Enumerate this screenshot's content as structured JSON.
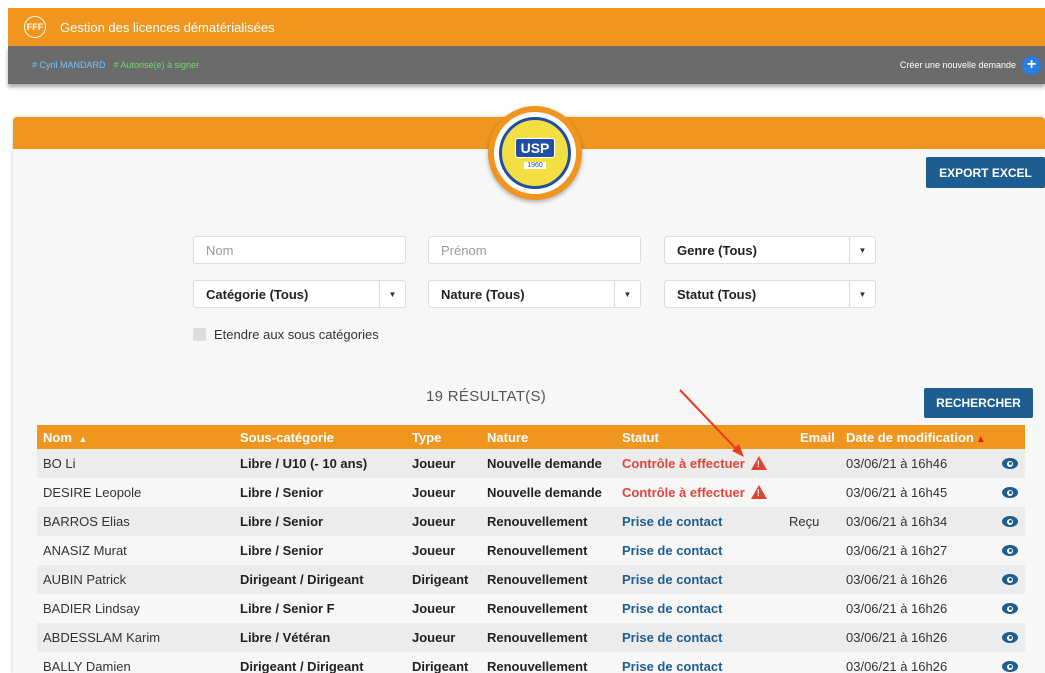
{
  "app": {
    "title": "Gestion des licences dématérialisées",
    "logo_text": "FFF"
  },
  "subbar": {
    "user": "# Cyril MANDARD",
    "authorization": "# Autorisé(e) à signer",
    "create_label": "Créer une nouvelle demande",
    "create_icon": "+"
  },
  "club": {
    "badge": "USP",
    "year": "1960"
  },
  "actions": {
    "export": "EXPORT EXCEL",
    "search": "RECHERCHER"
  },
  "filters": {
    "nom_placeholder": "Nom",
    "prenom_placeholder": "Prénom",
    "genre": "Genre (Tous)",
    "categorie": "Catégorie (Tous)",
    "nature": "Nature (Tous)",
    "statut": "Statut (Tous)",
    "extend_label": "Etendre aux sous catégories"
  },
  "results_label": "19 RÉSULTAT(S)",
  "table": {
    "headers": {
      "nom": "Nom",
      "nom_sort": "▲",
      "sous_categorie": "Sous-catégorie",
      "type": "Type",
      "nature": "Nature",
      "statut": "Statut",
      "email": "Email",
      "date": "Date de modification",
      "date_sort": "▲"
    },
    "rows": [
      {
        "nom": "BO Li",
        "sous_categorie": "Libre / U10 (- 10 ans)",
        "type": "Joueur",
        "nature": "Nouvelle demande",
        "statut": "Contrôle à effectuer",
        "email": "",
        "date": "03/06/21 à 16h46"
      },
      {
        "nom": "DESIRE Leopole",
        "sous_categorie": "Libre / Senior",
        "type": "Joueur",
        "nature": "Nouvelle demande",
        "statut": "Contrôle à effectuer",
        "email": "",
        "date": "03/06/21 à 16h45"
      },
      {
        "nom": "BARROS Elias",
        "sous_categorie": "Libre / Senior",
        "type": "Joueur",
        "nature": "Renouvellement",
        "statut": "Prise de contact",
        "email": "Reçu",
        "date": "03/06/21 à 16h34"
      },
      {
        "nom": "ANASIZ Murat",
        "sous_categorie": "Libre / Senior",
        "type": "Joueur",
        "nature": "Renouvellement",
        "statut": "Prise de contact",
        "email": "",
        "date": "03/06/21 à 16h27"
      },
      {
        "nom": "AUBIN Patrick",
        "sous_categorie": "Dirigeant / Dirigeant",
        "type": "Dirigeant",
        "nature": "Renouvellement",
        "statut": "Prise de contact",
        "email": "",
        "date": "03/06/21 à 16h26"
      },
      {
        "nom": "BADIER Lindsay",
        "sous_categorie": "Libre / Senior F",
        "type": "Joueur",
        "nature": "Renouvellement",
        "statut": "Prise de contact",
        "email": "",
        "date": "03/06/21 à 16h26"
      },
      {
        "nom": "ABDESSLAM Karim",
        "sous_categorie": "Libre / Vétéran",
        "type": "Joueur",
        "nature": "Renouvellement",
        "statut": "Prise de contact",
        "email": "",
        "date": "03/06/21 à 16h26"
      },
      {
        "nom": "BALLY Damien",
        "sous_categorie": "Dirigeant / Dirigeant",
        "type": "Dirigeant",
        "nature": "Renouvellement",
        "statut": "Prise de contact",
        "email": "",
        "date": "03/06/21 à 16h26"
      }
    ]
  },
  "colors": {
    "brand_orange": "#f0961f",
    "primary_blue": "#1d5d90",
    "alert_red": "#e0453a",
    "subbar_gray": "#6b6b6b"
  },
  "icons": {
    "row_action": "eye-icon",
    "alert": "warning-icon",
    "add": "plus-icon"
  }
}
